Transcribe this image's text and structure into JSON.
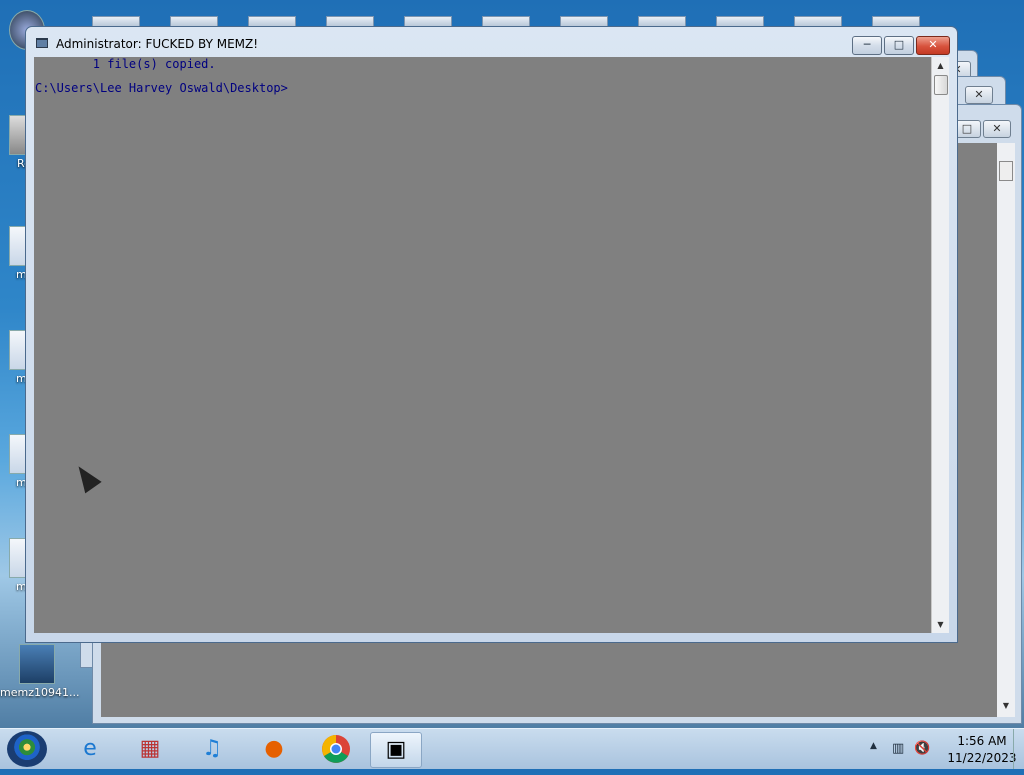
{
  "window": {
    "title": "Administrator:  FUCKED BY MEMZ!",
    "minimize_glyph": "─",
    "maximize_glyph": "□",
    "close_glyph": "✕"
  },
  "console": {
    "lines": [
      "        1 file(s) copied.",
      "",
      "C:\\Users\\Lee Harvey Oswald\\Desktop>"
    ],
    "background": "#808080",
    "text_color": "#000080"
  },
  "desktop": {
    "icons": [
      {
        "label": "mer",
        "icon": "memz-shortcut-icon"
      },
      {
        "label": "mer",
        "icon": "memz-shortcut-icon"
      },
      {
        "label": "mer",
        "icon": "memz-shortcut-icon"
      },
      {
        "label": "mer",
        "icon": "memz-shortcut-icon"
      },
      {
        "label": "memz10941...",
        "icon": "memz-exe-icon"
      }
    ],
    "partial_labels": {
      "recycle": "Rec"
    }
  },
  "taskbar": {
    "apps": [
      {
        "name": "internet-explorer",
        "glyph": "e"
      },
      {
        "name": "store",
        "glyph": "▦"
      },
      {
        "name": "music",
        "glyph": "♫"
      },
      {
        "name": "firefox",
        "glyph": "●"
      },
      {
        "name": "chrome",
        "glyph": "◉"
      },
      {
        "name": "command-prompt",
        "glyph": "▣"
      }
    ],
    "clock": {
      "time": "1:56 AM",
      "date": "11/22/2023"
    },
    "tray_glyphs": {
      "arrow": "▲",
      "network": "▥",
      "volume": "🔇"
    }
  },
  "scrollbar": {
    "up": "▲",
    "down": "▼"
  }
}
